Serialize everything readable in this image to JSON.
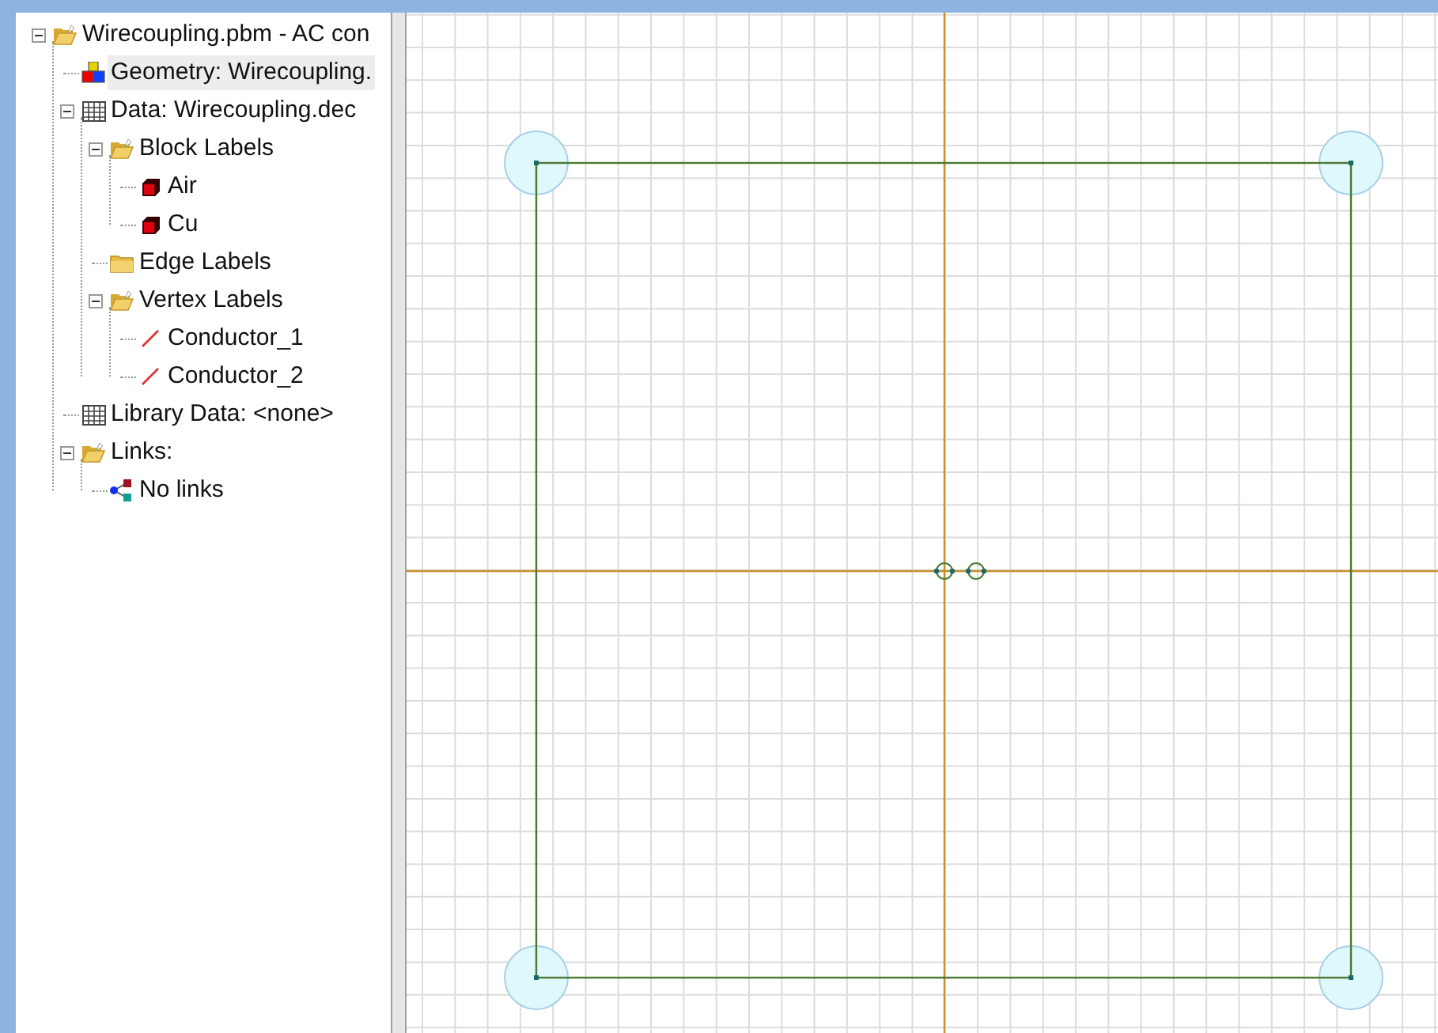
{
  "tree": [
    {
      "label": "Wirecoupling.pbm - AC con",
      "kind": "folder",
      "expanded": true,
      "selected": false,
      "children": [
        {
          "label": "Geometry: Wirecoupling.",
          "kind": "geometry",
          "selected": true
        },
        {
          "label": "Data: Wirecoupling.dec",
          "kind": "table",
          "expanded": true,
          "selected": false,
          "children": [
            {
              "label": "Block Labels",
              "kind": "folder",
              "expanded": true,
              "selected": false,
              "children": [
                {
                  "label": "Air",
                  "kind": "block",
                  "selected": false
                },
                {
                  "label": "Cu",
                  "kind": "block",
                  "selected": false
                }
              ]
            },
            {
              "label": "Edge Labels",
              "kind": "closed-folder",
              "selected": false
            },
            {
              "label": "Vertex Labels",
              "kind": "folder",
              "expanded": true,
              "selected": false,
              "children": [
                {
                  "label": "Conductor_1",
                  "kind": "vertex",
                  "selected": false
                },
                {
                  "label": "Conductor_2",
                  "kind": "vertex",
                  "selected": false
                }
              ]
            }
          ]
        },
        {
          "label": "Library Data: <none>",
          "kind": "table",
          "selected": false
        },
        {
          "label": "Links:",
          "kind": "folder",
          "expanded": true,
          "selected": false,
          "children": [
            {
              "label": "No links",
              "kind": "links",
              "selected": false
            }
          ]
        }
      ]
    }
  ]
}
